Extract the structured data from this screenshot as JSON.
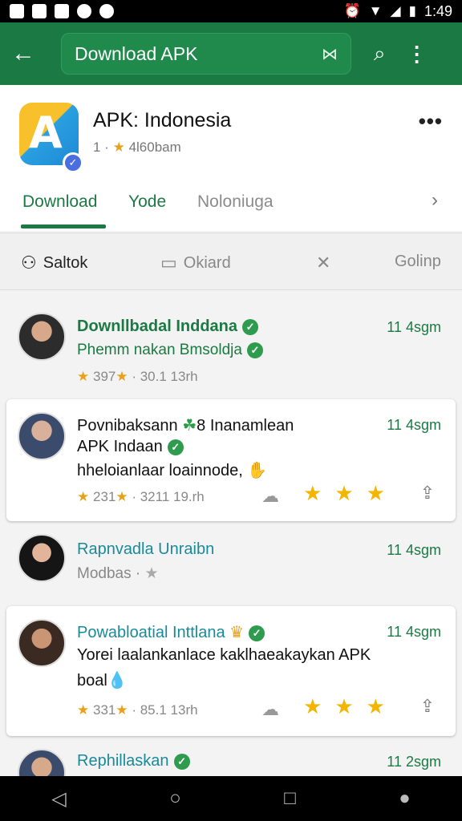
{
  "status": {
    "time": "1:49"
  },
  "appbar": {
    "search_text": "Download APK",
    "clear_icon": "close-icon",
    "search_icon": "search-icon",
    "more_icon": "more-vert-icon"
  },
  "app": {
    "title": "APK: Indonesia",
    "subtitle_prefix": "1 ·",
    "subtitle": "4l60bam",
    "more": "•••"
  },
  "tabs": [
    {
      "label": "Download"
    },
    {
      "label": "Yode"
    },
    {
      "label": "Noloniuga"
    }
  ],
  "filters": [
    {
      "label": "Saltok",
      "icon": "person-icon"
    },
    {
      "label": "Okiard",
      "icon": "monitor-icon"
    },
    {
      "label": "",
      "icon": "shuffle-icon"
    },
    {
      "label": "Golinp",
      "icon": ""
    }
  ],
  "items": [
    {
      "name": "Downllbadal Inddana",
      "time": "11 4sgm",
      "line2": "Phemm nakan Bmsoldja",
      "meta_rating": "397",
      "meta_rest": "· 30.1 13rh"
    },
    {
      "name": "Povnibaksann",
      "name_extra": "8 Inanamlean",
      "line_a": "APK Indaan",
      "line_b": "hheloianlaar loainnode,",
      "time": "11 4sgm",
      "meta_rating": "231",
      "meta_rest": "· 3211 19.rh"
    },
    {
      "name": "Rapnvadla Unraibn",
      "time": "11 4sgm",
      "line2": "Modbas"
    },
    {
      "name": "Powabloatial Inttlana",
      "time": "11 4sgm",
      "line_a": "Yorei laalankanlace kaklhaeakaykan APK",
      "line_b": "boal",
      "meta_rating": "331",
      "meta_rest": "· 85.1 13rh"
    },
    {
      "name": "Rephillaskan",
      "time": "11 2sgm"
    }
  ]
}
